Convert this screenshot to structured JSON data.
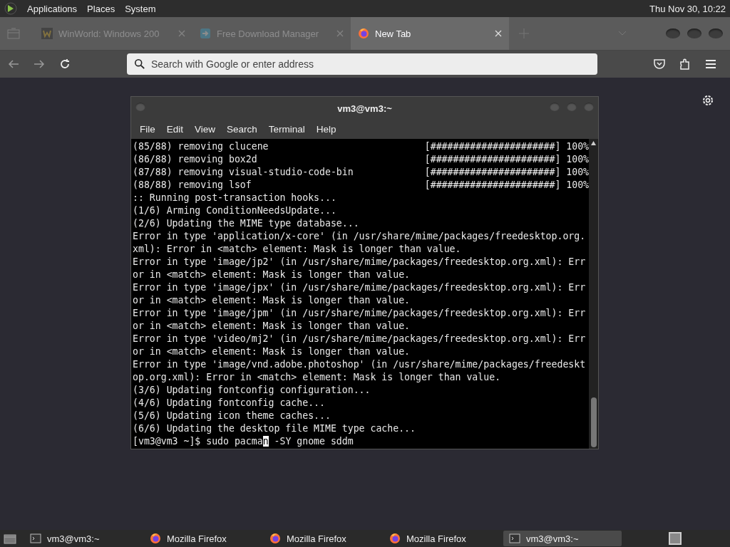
{
  "top_panel": {
    "menus": [
      "Applications",
      "Places",
      "System"
    ],
    "clock": "Thu Nov 30, 10:22"
  },
  "browser": {
    "tabs": [
      {
        "title": "WinWorld: Windows 200",
        "selected": false
      },
      {
        "title": "Free Download Manager",
        "selected": false
      },
      {
        "title": "New Tab",
        "selected": true
      }
    ],
    "address_placeholder": "Search with Google or enter address"
  },
  "terminal": {
    "title": "vm3@vm3:~",
    "menu": [
      "File",
      "Edit",
      "View",
      "Search",
      "Terminal",
      "Help"
    ],
    "lines": [
      {
        "kind": "progress",
        "text": "(85/88) removing clucene",
        "bar": "[######################] 100%"
      },
      {
        "kind": "progress",
        "text": "(86/88) removing box2d",
        "bar": "[######################] 100%"
      },
      {
        "kind": "progress",
        "text": "(87/88) removing visual-studio-code-bin",
        "bar": "[######################] 100%"
      },
      {
        "kind": "progress",
        "text": "(88/88) removing lsof",
        "bar": "[######################] 100%"
      },
      {
        "kind": "text",
        "text": ":: Running post-transaction hooks..."
      },
      {
        "kind": "text",
        "text": "(1/6) Arming ConditionNeedsUpdate..."
      },
      {
        "kind": "text",
        "text": "(2/6) Updating the MIME type database..."
      },
      {
        "kind": "text",
        "text": "Error in type 'application/x-core' (in /usr/share/mime/packages/freedesktop.org."
      },
      {
        "kind": "text",
        "text": "xml): Error in <match> element: Mask is longer than value."
      },
      {
        "kind": "text",
        "text": "Error in type 'image/jp2' (in /usr/share/mime/packages/freedesktop.org.xml): Err"
      },
      {
        "kind": "text",
        "text": "or in <match> element: Mask is longer than value."
      },
      {
        "kind": "text",
        "text": "Error in type 'image/jpx' (in /usr/share/mime/packages/freedesktop.org.xml): Err"
      },
      {
        "kind": "text",
        "text": "or in <match> element: Mask is longer than value."
      },
      {
        "kind": "text",
        "text": "Error in type 'image/jpm' (in /usr/share/mime/packages/freedesktop.org.xml): Err"
      },
      {
        "kind": "text",
        "text": "or in <match> element: Mask is longer than value."
      },
      {
        "kind": "text",
        "text": "Error in type 'video/mj2' (in /usr/share/mime/packages/freedesktop.org.xml): Err"
      },
      {
        "kind": "text",
        "text": "or in <match> element: Mask is longer than value."
      },
      {
        "kind": "text",
        "text": "Error in type 'image/vnd.adobe.photoshop' (in /usr/share/mime/packages/freedeskt"
      },
      {
        "kind": "text",
        "text": "op.org.xml): Error in <match> element: Mask is longer than value."
      },
      {
        "kind": "text",
        "text": "(3/6) Updating fontconfig configuration..."
      },
      {
        "kind": "text",
        "text": "(4/6) Updating fontconfig cache..."
      },
      {
        "kind": "text",
        "text": "(5/6) Updating icon theme caches..."
      },
      {
        "kind": "text",
        "text": "(6/6) Updating the desktop file MIME type cache..."
      }
    ],
    "prompt": {
      "before": "[vm3@vm3 ~]$ sudo pacma",
      "cursor": "n",
      "after": " -SY gnome sddm"
    }
  },
  "taskbar": [
    {
      "label": "vm3@vm3:~",
      "kind": "terminal",
      "selected": false
    },
    {
      "label": "Mozilla Firefox",
      "kind": "browser",
      "selected": false
    },
    {
      "label": "Mozilla Firefox",
      "kind": "browser",
      "selected": false
    },
    {
      "label": "Mozilla Firefox",
      "kind": "browser",
      "selected": false
    },
    {
      "label": "vm3@vm3:~",
      "kind": "terminal",
      "selected": true
    }
  ]
}
